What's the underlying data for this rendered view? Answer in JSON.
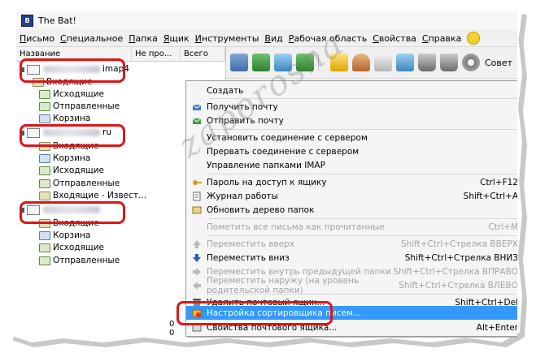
{
  "window": {
    "title": "The Bat!"
  },
  "menubar": [
    "Письмо",
    "Специальное",
    "Папка",
    "Ящик",
    "Инструменты",
    "Вид",
    "Рабочая область",
    "Свойства",
    "Справка"
  ],
  "folder_columns": {
    "name": "Название",
    "unread": "Не про...",
    "total": "Всего"
  },
  "accounts": [
    {
      "suffix": "imap4",
      "folders": [
        "Входящие",
        "Исходящие",
        "Отправленные",
        "Корзина"
      ]
    },
    {
      "suffix": "ru",
      "folders": [
        "Входящие",
        "Корзина",
        "Исходящие",
        "Отправленные",
        "Входящие - Извест..."
      ]
    },
    {
      "suffix": "",
      "folders": [
        "Входящие",
        "Корзина",
        "Исходящие",
        "Отправленные"
      ]
    }
  ],
  "toolbar": {
    "label": "Совет"
  },
  "bottom_numbers": [
    "0",
    "0"
  ],
  "context_menu": [
    {
      "label": "Создать",
      "shortcut": "",
      "icon": "",
      "disabled": false,
      "submenu": true
    },
    {
      "label": "Получить почту",
      "shortcut": "",
      "icon": "get-mail-icon",
      "disabled": false
    },
    {
      "label": "Отправить почту",
      "shortcut": "",
      "icon": "send-mail-icon",
      "disabled": false
    },
    {
      "label": "Установить соединение с сервером",
      "shortcut": "",
      "icon": "",
      "disabled": false
    },
    {
      "label": "Прервать соединение с сервером",
      "shortcut": "",
      "icon": "",
      "disabled": false
    },
    {
      "label": "Управление папками IMAP",
      "shortcut": "",
      "icon": "",
      "disabled": false
    },
    {
      "label": "Пароль на доступ к ящику",
      "shortcut": "Ctrl+F12",
      "icon": "key-icon",
      "disabled": false
    },
    {
      "label": "Журнал работы",
      "shortcut": "Shift+Ctrl+A",
      "icon": "log-icon",
      "disabled": false
    },
    {
      "label": "Обновить дерево папок",
      "shortcut": "",
      "icon": "refresh-icon",
      "disabled": false
    },
    {
      "label": "Пометить все письма как прочитанные",
      "shortcut": "Ctrl+M",
      "icon": "",
      "disabled": true
    },
    {
      "label": "Переместить вверх",
      "shortcut": "Shift+Ctrl+Стрелка ВВЕРХ",
      "icon": "arrow-up-icon",
      "disabled": true
    },
    {
      "label": "Переместить вниз",
      "shortcut": "Shift+Ctrl+Стрелка ВНИЗ",
      "icon": "arrow-down-icon",
      "disabled": false
    },
    {
      "label": "Переместить внутрь предыдущей папки",
      "shortcut": "Shift+Ctrl+Стрелка ВПРАВО",
      "icon": "arrow-right-icon",
      "disabled": true
    },
    {
      "label": "Переместить наружу (на уровень родительской папки)",
      "shortcut": "Shift+Ctrl+Стрелка ВЛЕВО",
      "icon": "arrow-left-icon",
      "disabled": true
    },
    {
      "label": "Удалить почтовый ящик...",
      "shortcut": "Shift+Ctrl+Del",
      "icon": "delete-icon",
      "disabled": false
    },
    {
      "label": "Настройка сортировщика писем...",
      "shortcut": "",
      "icon": "sorter-icon",
      "disabled": false,
      "selected": true
    },
    {
      "label": "Свойства почтового ящика...",
      "shortcut": "Alt+Enter",
      "icon": "properties-icon",
      "disabled": false
    }
  ],
  "watermark": "zaporosna",
  "colors": {
    "highlight": "#d81818",
    "selection": "#3399ff"
  }
}
